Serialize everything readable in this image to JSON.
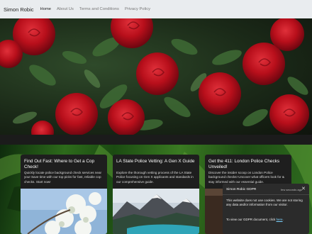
{
  "navbar": {
    "brand": "Simon Robic",
    "links": [
      {
        "label": "Home"
      },
      {
        "label": "About Us"
      },
      {
        "label": "Terms and Conditions"
      },
      {
        "label": "Privacy Policy"
      }
    ]
  },
  "cards": [
    {
      "title": "Find Out Fast: Where to Get a Cop Check!",
      "text": "Quickly locate police background check services near you! Save time with our top picks for fast, reliable cop checks. Start now!"
    },
    {
      "title": "LA State Police Vetting: A Gen X Guide",
      "text": "Explore the thorough vetting process of the LA State Police focusing on Gen X applicants and standards in our comprehensive guide."
    },
    {
      "title": "Get the 411: London Police Checks Unveiled!",
      "text": "Discover the insider scoop on London Police background checks! Uncover what officers look for & stay informed with our essential guide."
    }
  ],
  "gdpr": {
    "title": "Simon Robic GDPR",
    "time": "few seconds ago",
    "close": "✕",
    "body": "This website does not use cookies. We are not storing any data and/or information from our visitor.",
    "link_prefix": "To view our GDPR document, click ",
    "link_text": "here",
    "link_suffix": "."
  },
  "colors": {
    "navbar_bg": "#e9ecef",
    "card_bg": "#1e1e1e",
    "gdpr_bg": "#2b2b2b",
    "rose_red": "#c4101c",
    "link_blue": "#7cd3ff"
  }
}
